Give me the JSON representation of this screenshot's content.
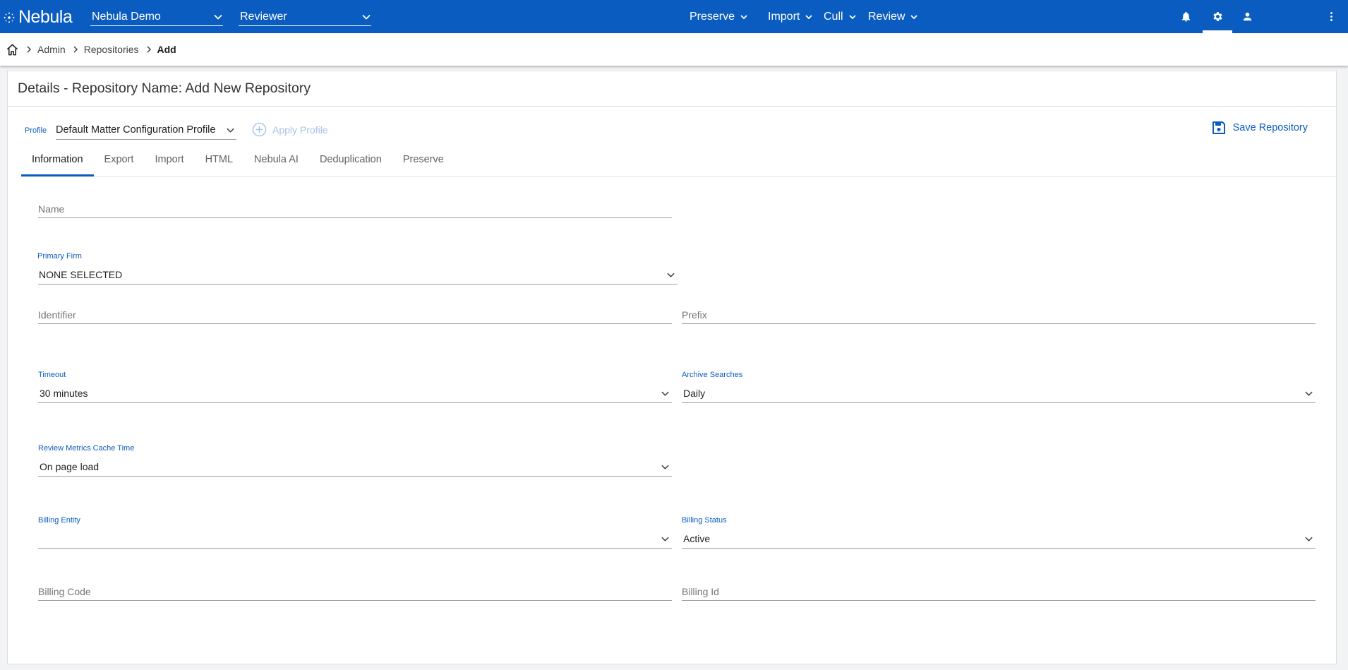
{
  "app": {
    "logo_text": "Nebula"
  },
  "topbar": {
    "matter_select": "Nebula Demo",
    "role_select": "Reviewer",
    "menus": [
      "Preserve",
      "Import",
      "Cull",
      "Review"
    ]
  },
  "breadcrumb": {
    "items": [
      "Admin",
      "Repositories"
    ],
    "current": "Add"
  },
  "page": {
    "title": "Details - Repository Name: Add New Repository"
  },
  "profile": {
    "label": "Profile",
    "value": "Default Matter Configuration Profile",
    "apply_label": "Apply Profile",
    "save_label": "Save Repository"
  },
  "tabs": [
    "Information",
    "Export",
    "Import",
    "HTML",
    "Nebula AI",
    "Deduplication",
    "Preserve"
  ],
  "form": {
    "name": {
      "placeholder": "Name"
    },
    "primary_firm": {
      "label": "Primary Firm",
      "value": "NONE SELECTED"
    },
    "identifier": {
      "placeholder": "Identifier"
    },
    "prefix": {
      "placeholder": "Prefix"
    },
    "timeout": {
      "label": "Timeout",
      "value": "30 minutes"
    },
    "archive_searches": {
      "label": "Archive Searches",
      "value": "Daily"
    },
    "review_metrics_cache_time": {
      "label": "Review Metrics Cache Time",
      "value": "On page load"
    },
    "billing_entity": {
      "label": "Billing Entity",
      "value": ""
    },
    "billing_status": {
      "label": "Billing Status",
      "value": "Active"
    },
    "billing_code": {
      "placeholder": "Billing Code"
    },
    "billing_id": {
      "placeholder": "Billing Id"
    }
  },
  "colors": {
    "primary": "#0a5cc0",
    "apply_disabled": "#a9c3e6"
  },
  "icons": [
    "nebula-logo-icon",
    "chevron-down-icon",
    "bell-icon",
    "gear-icon",
    "user-icon",
    "more-vertical-icon",
    "home-icon",
    "chevron-right-icon",
    "add-circle-icon",
    "save-icon"
  ]
}
